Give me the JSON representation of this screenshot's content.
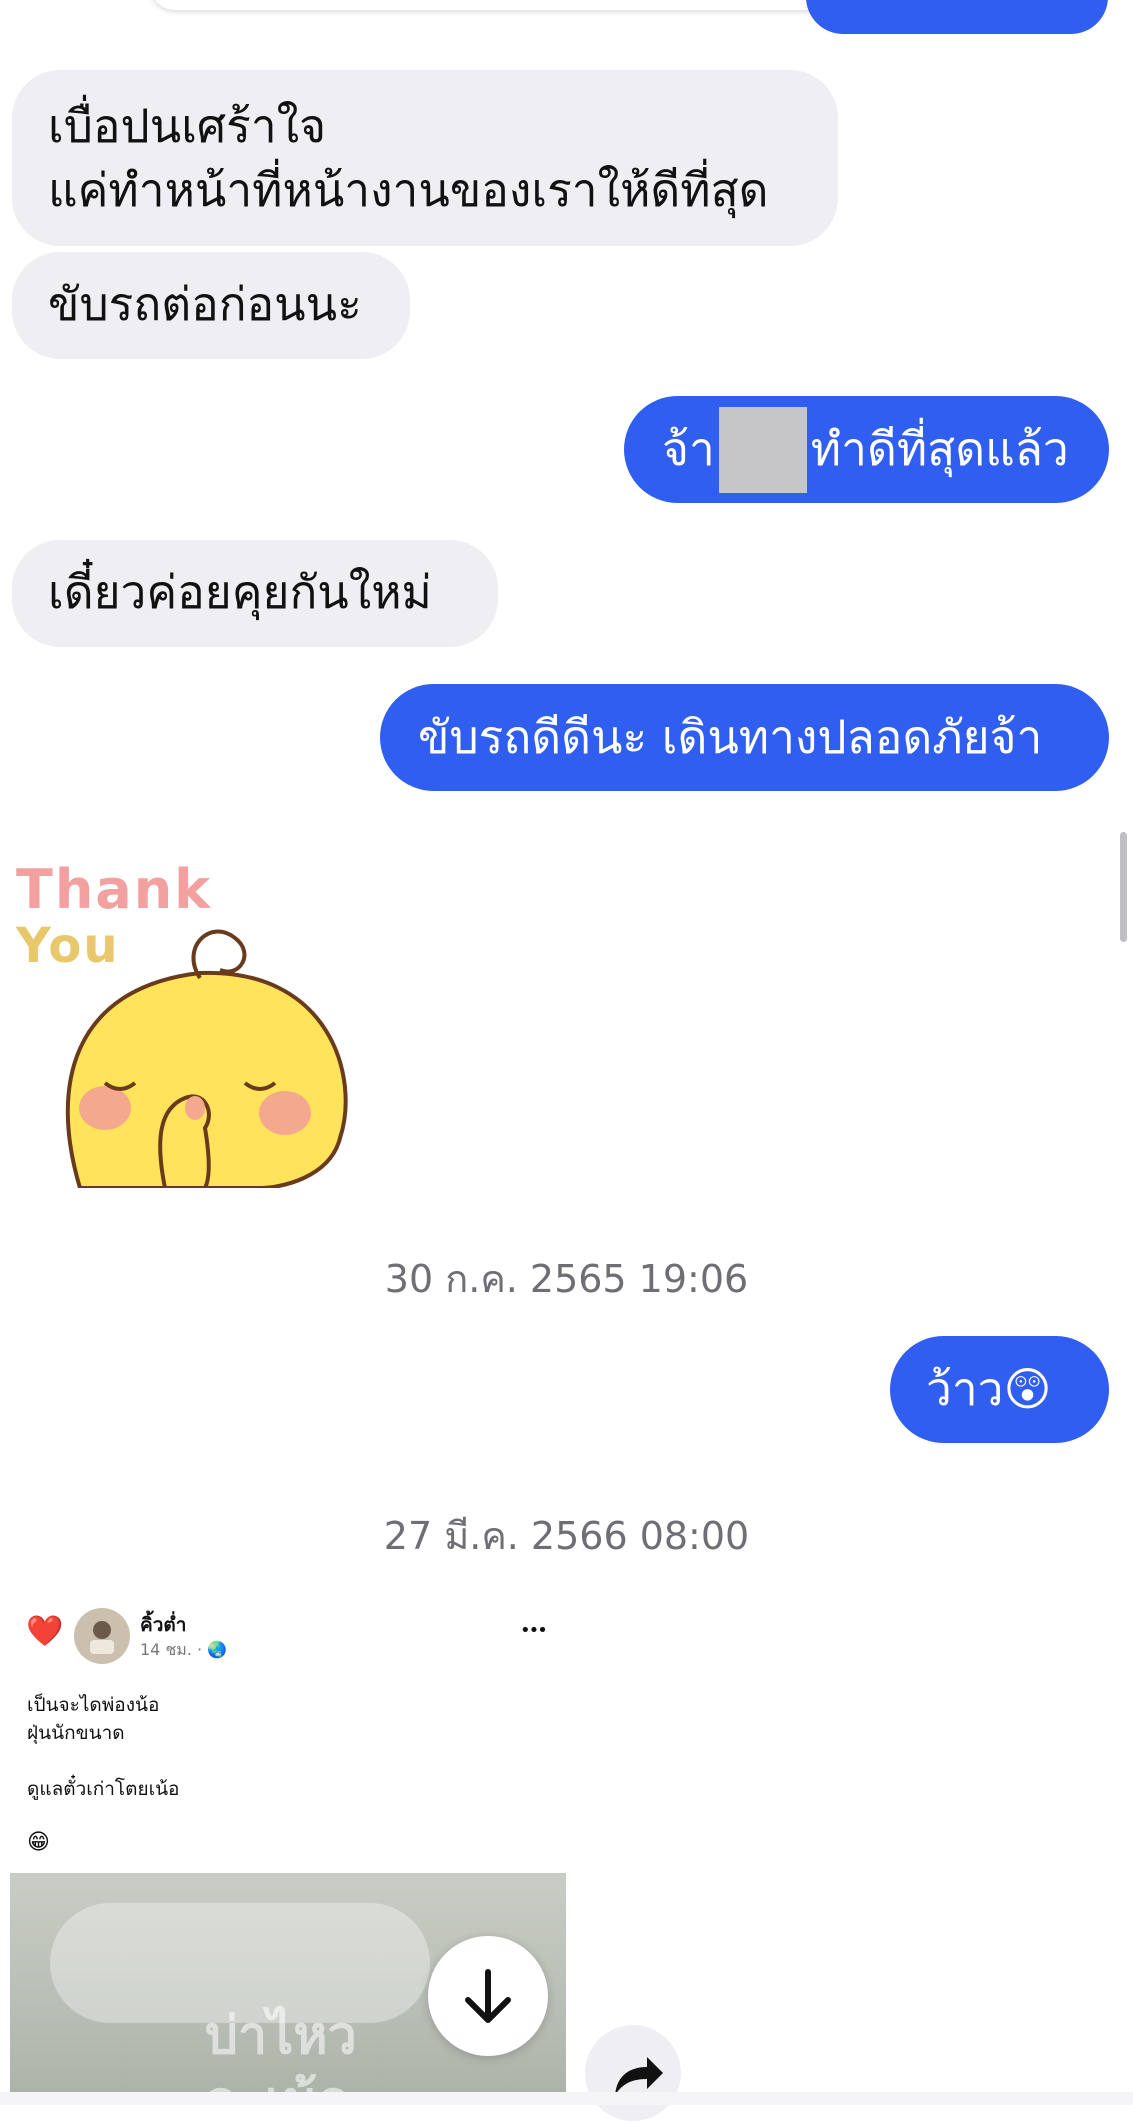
{
  "messages": {
    "m1_line1": "เบื่อปนเศร้าใจ",
    "m1_line2": "แค่ทำหน้าที่หน้างานของเราให้ดีที่สุด",
    "m2": "ขับรถต่อก่อนนะ",
    "m3_pre": "จ้า",
    "m3_post": "ทำดีที่สุดแล้ว",
    "m4": "เดี๋ยวค่อยคุยกันใหม่",
    "m5": "ขับรถดีดีนะ เดินทางปลอดภัยจ้า",
    "m6": "ว้าว😲"
  },
  "sticker": {
    "line1": "Thank",
    "line2": "You",
    "icon": "chick-thank-you-sticker"
  },
  "timestamps": {
    "t1": "30 ก.ค. 2565 19:06",
    "t2": "27 มี.ค. 2566 08:00"
  },
  "shared_post": {
    "reaction": "❤️",
    "author": "คิ้วต่ำ",
    "meta": "14 ชม. · 🌏",
    "more": "•••",
    "line1": "เป็นจะไดพ่องน้อ",
    "line2": "ฝุ่นนักขนาด",
    "line3": "ดูแลตั๋วเก่าโตยเน้อ",
    "emoji": "😁",
    "image_text_1": "บ่าไหว",
    "image_text_2": "ละเน้อ"
  },
  "controls": {
    "scroll_down_icon": "arrow-down-icon",
    "share_icon": "share-arrow-icon"
  },
  "colors": {
    "outgoing": "#2f5ef0",
    "incoming": "#efeff3"
  }
}
